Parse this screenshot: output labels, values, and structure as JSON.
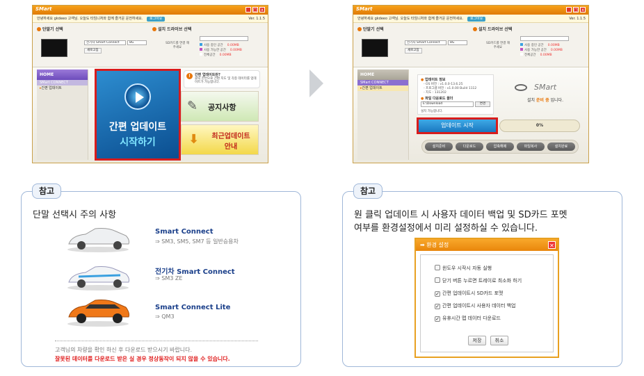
{
  "left_window": {
    "title": "SMart",
    "info_text": "안녕하세요 gkdeeo 고객님. 오늘도 타임니처와 함께 즐거운 운전하세요.",
    "login_label": "로그아웃",
    "version": "Ver. 1.1.5",
    "device_section": "단말기 선택",
    "driver_section": "설치 드라이브 선택",
    "device_select": "전기차 Smart Connect",
    "size_select": "8G",
    "new_button": "새로고침",
    "sd_label": "SD카드를 연결 해 주세요",
    "legend": [
      {
        "label": "사용 중인 공간",
        "value": "0.00MB",
        "color": "#3aa0e0"
      },
      {
        "label": "사용 가능한 공간",
        "value": "0.00MB",
        "color": "#c050c0"
      },
      {
        "label": "전체공간",
        "value": "0.00MB",
        "color": "#ffffff"
      }
    ],
    "nav_home": "HOME",
    "nav_items": [
      "SMart CONNECT",
      "간편 업데이트"
    ],
    "big_tile_line1": "간편 업데이트",
    "big_tile_line2": "시작하기",
    "notice_title": "간편 업데이트란?",
    "notice_text": "클릭 한번으로 간편 지도 및 각종 데이터를 업데이트가 가능합니다.",
    "tile_notice": "공지사항",
    "tile_recent_1": "최근업데이트",
    "tile_recent_2": "안내"
  },
  "right_window": {
    "title": "SMart",
    "info_text": "안녕하세요 gkdeeo 고객님. 오늘도 타임니처와 함께 즐거운 운전하세요.",
    "login_label": "로그아웃",
    "version": "Ver. 1.1.5",
    "device_section": "단말기 선택",
    "driver_section": "설치 드라이브 선택",
    "device_select": "전기차 Smart Connect",
    "size_select": "8G",
    "new_button": "새로고침",
    "sd_label": "SD카드를 연결 해 주세요",
    "legend": [
      {
        "label": "사용 중인 공간",
        "value": "0.00MB",
        "color": "#3aa0e0"
      },
      {
        "label": "사용 가능한 공간",
        "value": "0.00MB",
        "color": "#c050c0"
      },
      {
        "label": "전체공간",
        "value": "0.00MB",
        "color": "#ffffff"
      }
    ],
    "nav_home": "HOME",
    "nav_items": [
      "SMart CONNECT",
      "간편 업데이트"
    ],
    "update_info_title": "업데이트 정보",
    "update_info_lines": [
      "- OS 버전 : v1.0.0-13.6.25",
      "- 프로그램 버전 : v1.0.00 Build 1112",
      "- 지도 : 131202"
    ],
    "download_title": "파일 다운로드 폴더",
    "download_path": "E:\\Download",
    "change_button": "변경",
    "install_ready": "설치 가능합니다.",
    "brand": "SMart",
    "status_text_pre": "설치 ",
    "status_text_hl": "준비 중",
    "status_text_post": " 입니다.",
    "start_button": "업데이트 시작",
    "progress_label": "0%",
    "progress": 0,
    "bottom_buttons": [
      "설치준비",
      "다운로드",
      "압축해제",
      "파일복사",
      "설치완료"
    ]
  },
  "left_note": {
    "tab": "참고",
    "heading": "단말 선택시 주의 사항",
    "cars": [
      {
        "name": "Smart Connect",
        "sub": "⇒ SM3, SM5, SM7 등 일반승용차"
      },
      {
        "name": "전기차 Smart Connect",
        "sub": "⇒ SM3 ZE"
      },
      {
        "name": "Smart Connect Lite",
        "sub": "⇒ QM3"
      }
    ],
    "footer1": "고객님의 차량을 확인 하신 후 다운로드 받으시기 바랍니다.",
    "footer2": "잘못된 데이터를 다운로드 받은 실 경우 정상동작이 되지 않을 수 있습니다."
  },
  "right_note": {
    "tab": "참고",
    "line1": "원 클릭 업데이트 시 사용자 데이터 백업 및 SD카드 포멧",
    "line2": "여부를 환경설정에서 미리 설정하실 수 있습니다.",
    "dialog": {
      "title": "환경 설정",
      "options": [
        {
          "label": "윈도우 시작시 자동 실행",
          "checked": false
        },
        {
          "label": "닫기 버튼 누르면 트레이로 최소화 하기",
          "checked": false
        },
        {
          "label": "간편 업데이트시 SD카드 포멧",
          "checked": true
        },
        {
          "label": "간편 업데이트시 사용자 데이터 백업",
          "checked": true
        },
        {
          "label": "유휴시간 맵 데이터 다운로드",
          "checked": true
        }
      ],
      "save": "저장",
      "cancel": "취소"
    }
  }
}
